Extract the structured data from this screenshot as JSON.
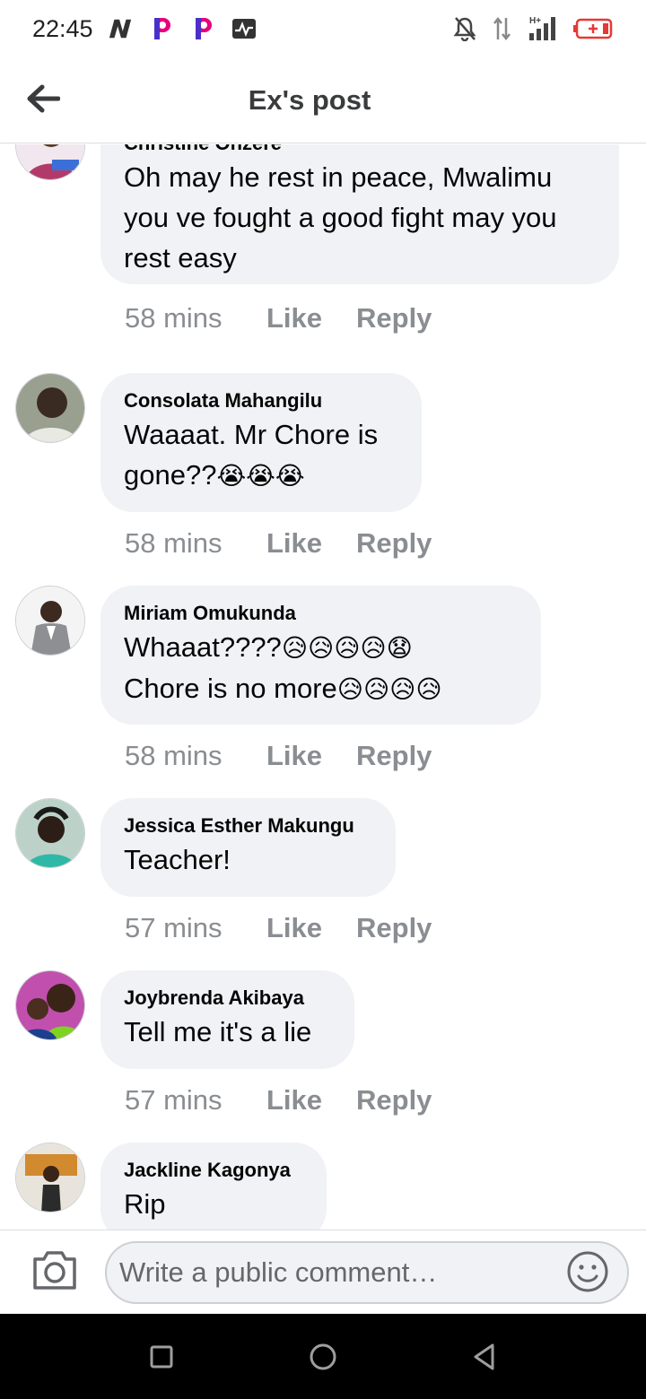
{
  "status_bar": {
    "time": "22:45",
    "left_icons": [
      "n-app-icon",
      "p-app-icon",
      "p-app-icon",
      "activity-icon"
    ],
    "right_icons": [
      "bell-off-icon",
      "data-arrows-icon",
      "signal-icon",
      "battery-icon"
    ],
    "network_label": "H+",
    "battery_color": "#e53935"
  },
  "header": {
    "title": "Ex's post",
    "back_icon": "arrow-left-icon"
  },
  "comments": [
    {
      "author": "Christine Onzere",
      "lines": [
        "Oh may he rest in peace, Mwalimu",
        "you ve fought a good fight may you",
        "rest easy"
      ],
      "time": "58 mins",
      "like": "Like",
      "reply": "Reply"
    },
    {
      "author": "Consolata Mahangilu",
      "lines": [
        "Waaaat. Mr Chore is",
        "gone??"
      ],
      "emoji_line2": "😭😭😭",
      "time": "58 mins",
      "like": "Like",
      "reply": "Reply"
    },
    {
      "author": "Miriam Omukunda",
      "line1": "Whaaat????",
      "emoji_line1": "😥😥😥😥😧",
      "line2": "Chore is no more",
      "emoji_line2": "😥😥😥😥",
      "time": "58 mins",
      "like": "Like",
      "reply": "Reply"
    },
    {
      "author": "Jessica Esther Makungu",
      "lines": [
        "Teacher!"
      ],
      "time": "57 mins",
      "like": "Like",
      "reply": "Reply"
    },
    {
      "author": "Joybrenda Akibaya",
      "lines": [
        "Tell me it's a lie"
      ],
      "time": "57 mins",
      "like": "Like",
      "reply": "Reply"
    },
    {
      "author": "Jackline Kagonya",
      "lines": [
        "Rip"
      ]
    }
  ],
  "composer": {
    "placeholder": "Write a public comment…",
    "camera_icon": "camera-icon",
    "emoji_icon": "smiley-icon"
  },
  "nav_bar": {
    "icons": [
      "recents-square-icon",
      "home-circle-icon",
      "back-triangle-icon"
    ]
  }
}
